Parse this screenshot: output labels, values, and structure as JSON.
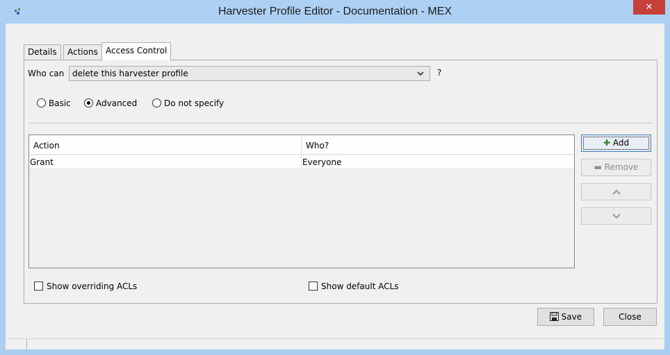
{
  "window": {
    "title": "Harvester Profile Editor - Documentation - MEX",
    "close_glyph": "✕"
  },
  "tabs": [
    {
      "label": "Details",
      "active": false
    },
    {
      "label": "Actions",
      "active": false
    },
    {
      "label": "Access Control",
      "active": true
    }
  ],
  "access_control": {
    "who_can_label": "Who can",
    "who_can_value": "delete this harvester profile",
    "dropdown_icon": "chevron-down-icon",
    "help_mark": "?",
    "mode_options": [
      {
        "label": "Basic",
        "selected": false
      },
      {
        "label": "Advanced",
        "selected": true
      },
      {
        "label": "Do not specify",
        "selected": false
      }
    ],
    "table": {
      "columns": [
        "Action",
        "Who?"
      ],
      "rows": [
        [
          "Grant",
          "Everyone"
        ]
      ]
    },
    "buttons": {
      "add": "Add",
      "remove": "Remove",
      "move_up_icon": "chevron-up-icon",
      "move_down_icon": "chevron-down-icon"
    },
    "checkboxes": {
      "show_overriding": {
        "label": "Show overriding ACLs",
        "checked": false
      },
      "show_default": {
        "label": "Show default ACLs",
        "checked": false
      }
    }
  },
  "footer": {
    "save_label": "Save",
    "close_label": "Close"
  },
  "colors": {
    "titlebar": "#aed0f2",
    "close_button": "#c7413a",
    "add_icon": "#2f7d2a"
  }
}
